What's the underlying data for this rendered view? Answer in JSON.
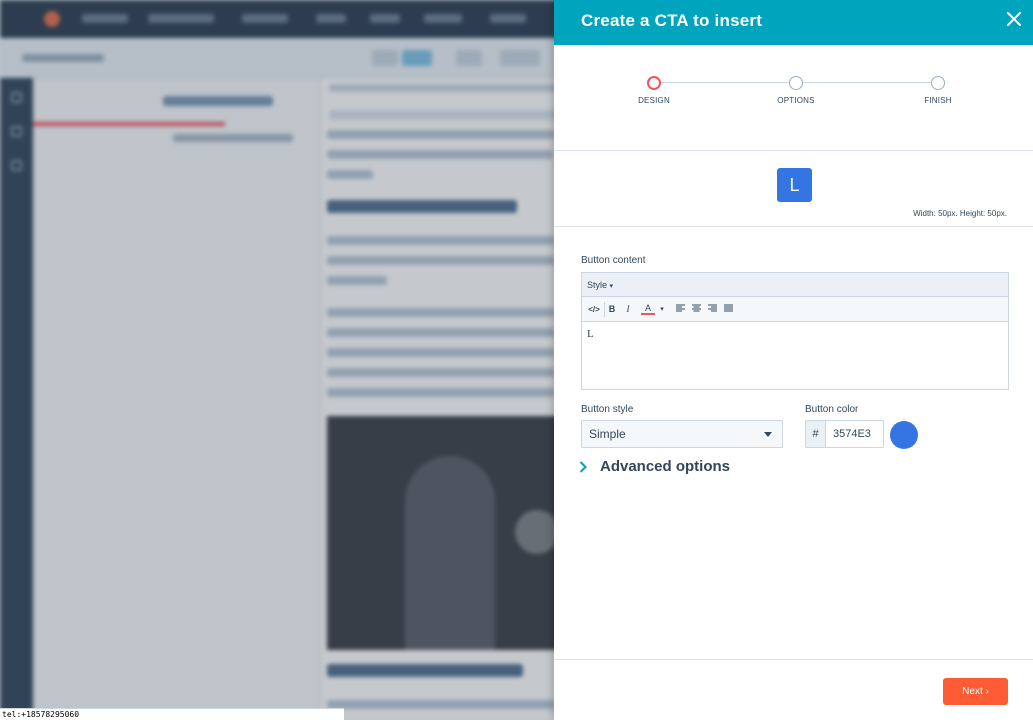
{
  "modal": {
    "title": "Create a CTA to insert",
    "close_icon": "close-icon"
  },
  "steps": [
    {
      "label": "DESIGN",
      "active": true
    },
    {
      "label": "OPTIONS",
      "active": false
    },
    {
      "label": "FINISH",
      "active": false
    }
  ],
  "preview": {
    "button_text": "L",
    "dimensions": "Width: 50px. Height: 50px."
  },
  "button_content": {
    "label": "Button content",
    "style_menu": "Style",
    "toolbar": {
      "source": "</>",
      "bold": "B",
      "italic": "I",
      "text_color": "A"
    },
    "body_text": "L"
  },
  "button_style": {
    "label": "Button style",
    "selected": "Simple"
  },
  "button_color": {
    "label": "Button color",
    "prefix": "#",
    "value": "3574E3",
    "swatch": "#3574E3"
  },
  "advanced": {
    "label": "Advanced options"
  },
  "footer": {
    "next_label": "Next",
    "next_color": "#FF5C35"
  },
  "status_bar": {
    "text": "tel:+18578295060"
  },
  "colors": {
    "header": "#00A4BD",
    "active_step": "#F2545B"
  }
}
